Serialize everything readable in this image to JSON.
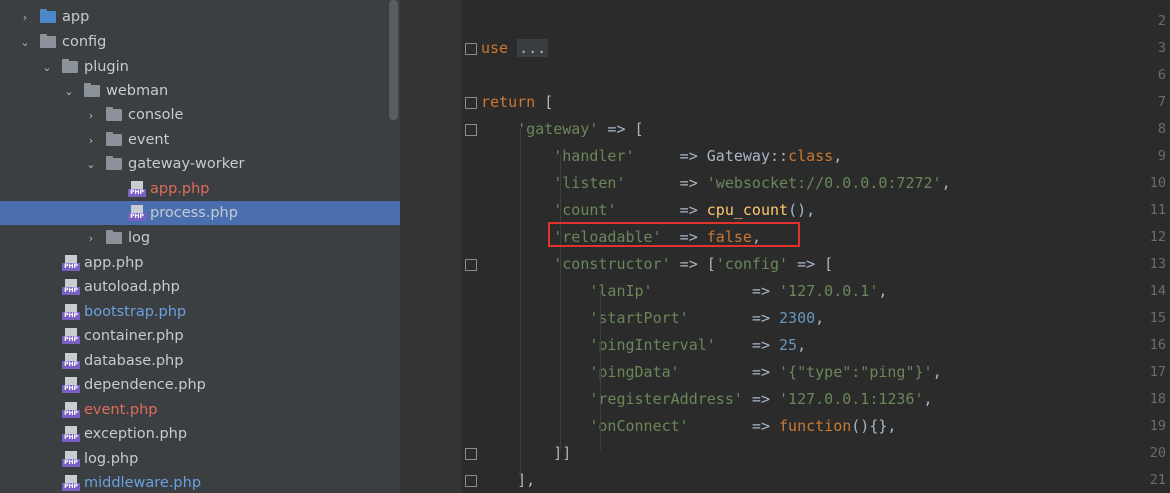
{
  "tree": [
    {
      "label": "app",
      "type": "folder",
      "color": "blue",
      "chevron": "›",
      "indent": 18
    },
    {
      "label": "config",
      "type": "folder",
      "chevron": "⌄",
      "indent": 18
    },
    {
      "label": "plugin",
      "type": "folder",
      "chevron": "⌄",
      "indent": 40
    },
    {
      "label": "webman",
      "type": "folder",
      "chevron": "⌄",
      "indent": 62
    },
    {
      "label": "console",
      "type": "folder",
      "chevron": "›",
      "indent": 84
    },
    {
      "label": "event",
      "type": "folder",
      "chevron": "›",
      "indent": 84
    },
    {
      "label": "gateway-worker",
      "type": "folder",
      "chevron": "⌄",
      "indent": 84
    },
    {
      "label": "app.php",
      "type": "php",
      "style": "red",
      "indent": 128
    },
    {
      "label": "process.php",
      "type": "php",
      "selected": true,
      "indent": 128
    },
    {
      "label": "log",
      "type": "folder",
      "chevron": "›",
      "indent": 84
    },
    {
      "label": "app.php",
      "type": "php",
      "indent": 62
    },
    {
      "label": "autoload.php",
      "type": "php",
      "indent": 62
    },
    {
      "label": "bootstrap.php",
      "type": "php",
      "style": "blue",
      "indent": 62
    },
    {
      "label": "container.php",
      "type": "php",
      "indent": 62
    },
    {
      "label": "database.php",
      "type": "php",
      "indent": 62
    },
    {
      "label": "dependence.php",
      "type": "php",
      "indent": 62
    },
    {
      "label": "event.php",
      "type": "php",
      "style": "red",
      "indent": 62
    },
    {
      "label": "exception.php",
      "type": "php",
      "indent": 62
    },
    {
      "label": "log.php",
      "type": "php",
      "indent": 62
    },
    {
      "label": "middleware.php",
      "type": "php",
      "style": "blue",
      "indent": 62
    }
  ],
  "editor": {
    "lines": [
      {
        "n": "2",
        "tokens": []
      },
      {
        "n": "3",
        "tokens": [
          [
            "kw",
            "use"
          ],
          [
            "t",
            " "
          ],
          [
            "fold",
            "..."
          ]
        ]
      },
      {
        "n": "6",
        "tokens": []
      },
      {
        "n": "7",
        "tokens": [
          [
            "kw",
            "return"
          ],
          [
            "t",
            " ["
          ]
        ]
      },
      {
        "n": "8",
        "tokens": [
          [
            "t",
            "    "
          ],
          [
            "str",
            "'gateway'"
          ],
          [
            "t",
            " => ["
          ]
        ]
      },
      {
        "n": "9",
        "tokens": [
          [
            "t",
            "        "
          ],
          [
            "str",
            "'handler'"
          ],
          [
            "t",
            "     => Gateway::"
          ],
          [
            "kw",
            "class"
          ],
          [
            "t",
            ","
          ]
        ]
      },
      {
        "n": "10",
        "tokens": [
          [
            "t",
            "        "
          ],
          [
            "str",
            "'listen'"
          ],
          [
            "t",
            "      => "
          ],
          [
            "str",
            "'websocket://0.0.0.0:7272'"
          ],
          [
            "t",
            ","
          ]
        ]
      },
      {
        "n": "11",
        "tokens": [
          [
            "t",
            "        "
          ],
          [
            "str",
            "'count'"
          ],
          [
            "t",
            "       => "
          ],
          [
            "fn",
            "cpu_count"
          ],
          [
            "t",
            "(),"
          ]
        ]
      },
      {
        "n": "12",
        "tokens": [
          [
            "t",
            "        "
          ],
          [
            "str",
            "'reloadable'"
          ],
          [
            "t",
            "  => "
          ],
          [
            "kw",
            "false"
          ],
          [
            "t",
            ","
          ]
        ]
      },
      {
        "n": "13",
        "tokens": [
          [
            "t",
            "        "
          ],
          [
            "str",
            "'constructor'"
          ],
          [
            "t",
            " => ["
          ],
          [
            "str",
            "'config'"
          ],
          [
            "t",
            " => ["
          ]
        ]
      },
      {
        "n": "14",
        "tokens": [
          [
            "t",
            "            "
          ],
          [
            "str",
            "'lanIp'"
          ],
          [
            "t",
            "           => "
          ],
          [
            "str",
            "'127.0.0.1'"
          ],
          [
            "t",
            ","
          ]
        ]
      },
      {
        "n": "15",
        "tokens": [
          [
            "t",
            "            "
          ],
          [
            "str",
            "'startPort'"
          ],
          [
            "t",
            "       => "
          ],
          [
            "num",
            "2300"
          ],
          [
            "t",
            ","
          ]
        ]
      },
      {
        "n": "16",
        "tokens": [
          [
            "t",
            "            "
          ],
          [
            "str",
            "'pingInterval'"
          ],
          [
            "t",
            "    => "
          ],
          [
            "num",
            "25"
          ],
          [
            "t",
            ","
          ]
        ]
      },
      {
        "n": "17",
        "tokens": [
          [
            "t",
            "            "
          ],
          [
            "str",
            "'pingData'"
          ],
          [
            "t",
            "        => "
          ],
          [
            "str",
            "'{\"type\":\"ping\"}'"
          ],
          [
            "t",
            ","
          ]
        ]
      },
      {
        "n": "18",
        "tokens": [
          [
            "t",
            "            "
          ],
          [
            "str",
            "'registerAddress'"
          ],
          [
            "t",
            " => "
          ],
          [
            "str",
            "'127.0.0.1:1236'"
          ],
          [
            "t",
            ","
          ]
        ]
      },
      {
        "n": "19",
        "tokens": [
          [
            "t",
            "            "
          ],
          [
            "str",
            "'onConnect'"
          ],
          [
            "t",
            "       => "
          ],
          [
            "kw",
            "function"
          ],
          [
            "t",
            "(){},"
          ]
        ]
      },
      {
        "n": "20",
        "tokens": [
          [
            "t",
            "        ]]"
          ]
        ]
      },
      {
        "n": "21",
        "tokens": [
          [
            "t",
            "    ],"
          ]
        ]
      }
    ]
  }
}
